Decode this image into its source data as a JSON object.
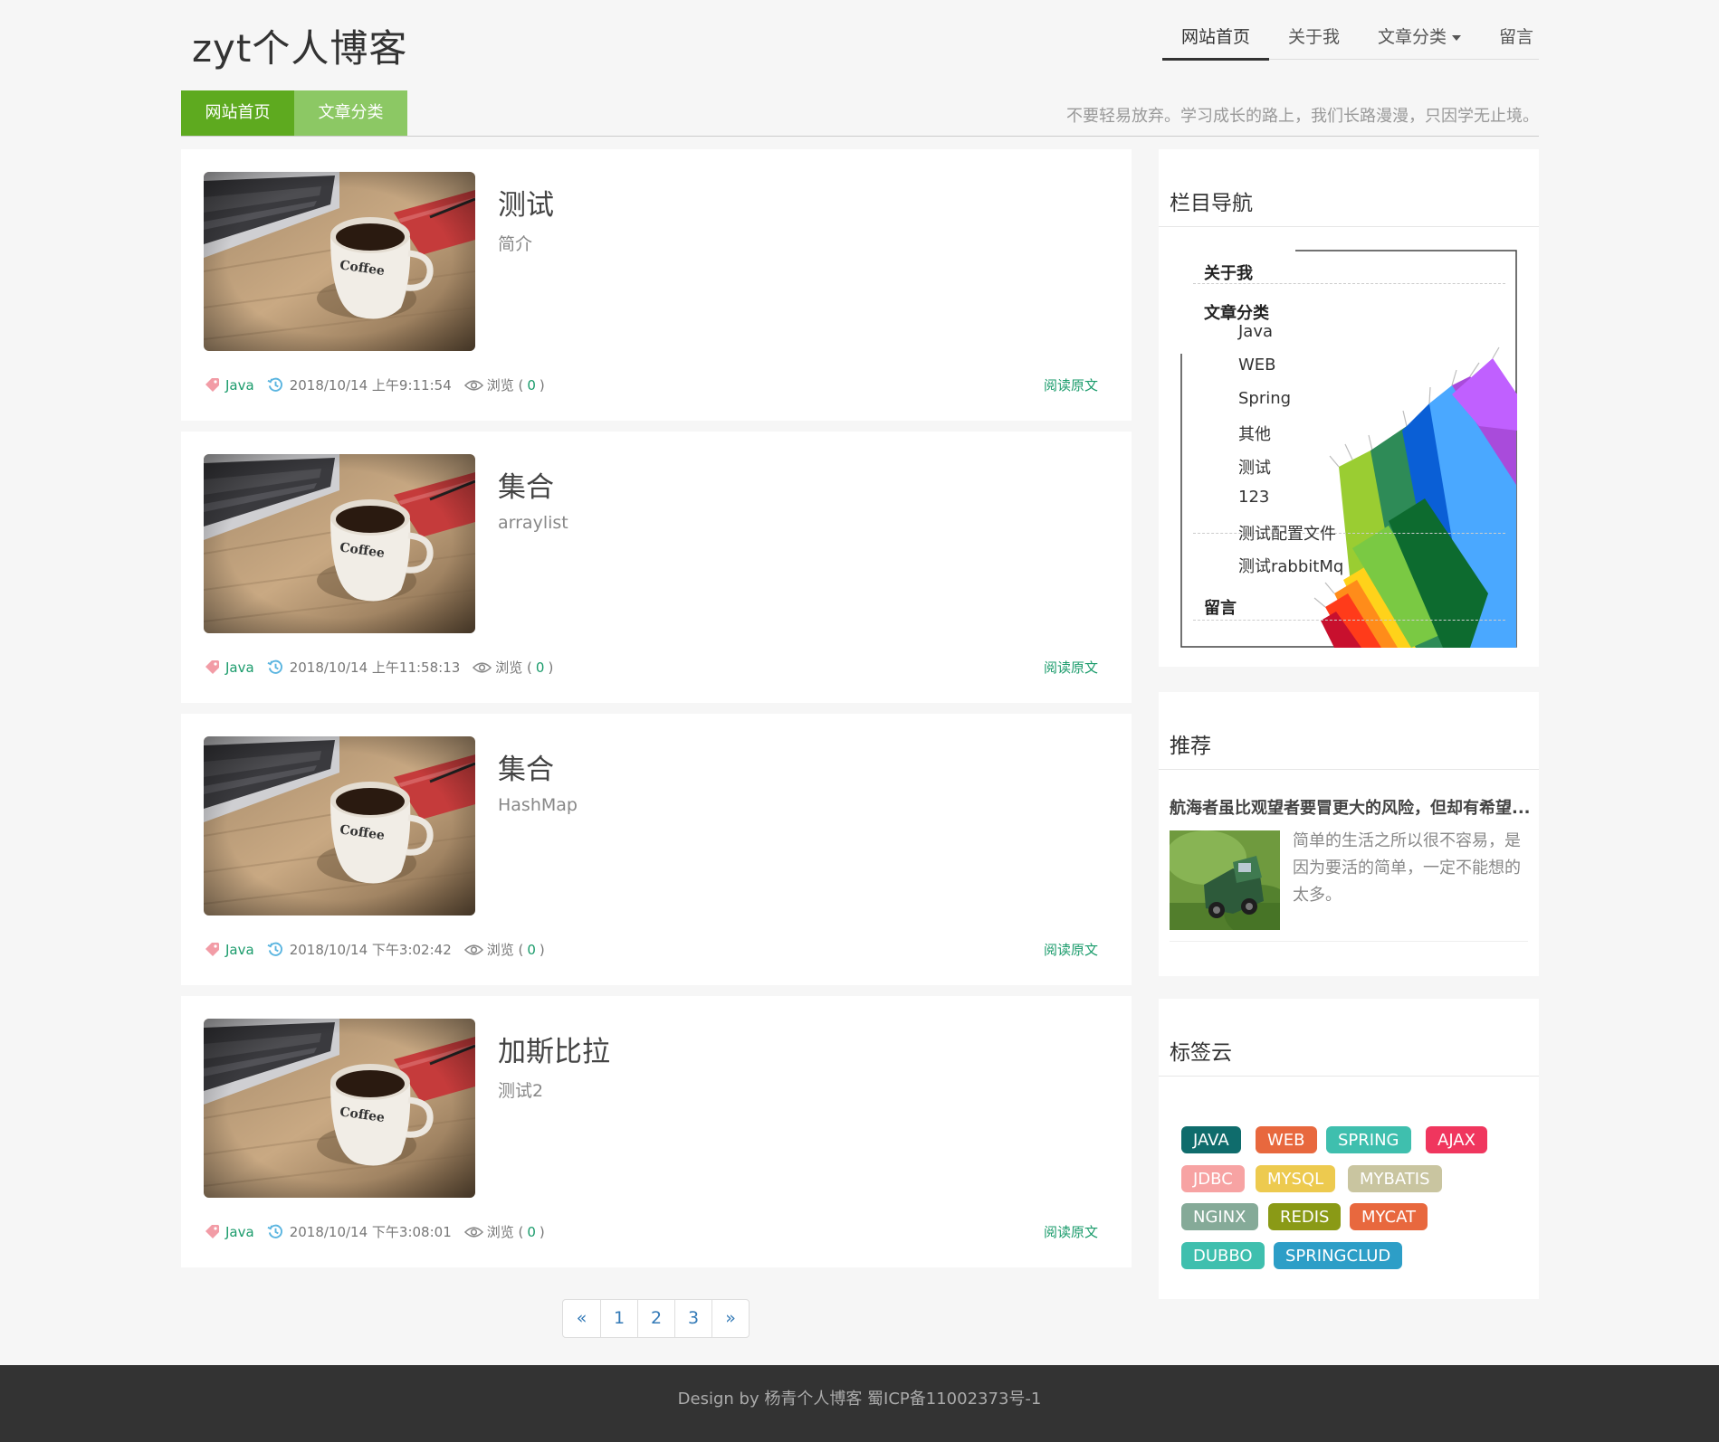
{
  "header": {
    "site_title": "zyt个人博客",
    "nav": [
      {
        "label": "网站首页",
        "active": true
      },
      {
        "label": "关于我",
        "active": false
      },
      {
        "label": "文章分类",
        "active": false,
        "dropdown": true
      },
      {
        "label": "留言",
        "active": false
      }
    ]
  },
  "subbar": {
    "tab_home": "网站首页",
    "tab_category": "文章分类",
    "motto": "不要轻易放弃。学习成长的路上，我们长路漫漫，只因学无止境。"
  },
  "articles": [
    {
      "title": "测试",
      "desc": "简介",
      "tag": "Java",
      "date": "2018/10/14 上午9:11:54",
      "views_label": "浏览 (",
      "views": "0",
      "views_end": ")",
      "read_more": "阅读原文"
    },
    {
      "title": "集合",
      "desc": "arraylist",
      "tag": "Java",
      "date": "2018/10/14 上午11:58:13",
      "views_label": "浏览 (",
      "views": "0",
      "views_end": ")",
      "read_more": "阅读原文"
    },
    {
      "title": "集合",
      "desc": "HashMap",
      "tag": "Java",
      "date": "2018/10/14 下午3:02:42",
      "views_label": "浏览 (",
      "views": "0",
      "views_end": ")",
      "read_more": "阅读原文"
    },
    {
      "title": "加斯比拉",
      "desc": "测试2",
      "tag": "Java",
      "date": "2018/10/14 下午3:08:01",
      "views_label": "浏览 (",
      "views": "0",
      "views_end": ")",
      "read_more": "阅读原文"
    }
  ],
  "pagination": {
    "prev": "«",
    "pages": [
      "1",
      "2",
      "3"
    ],
    "next": "»"
  },
  "sidebar": {
    "column_nav": {
      "title": "栏目导航",
      "about": "关于我",
      "category": "文章分类",
      "subcategories": [
        "Java",
        "WEB",
        "Spring",
        "其他",
        "测试",
        "123",
        "测试配置文件",
        "测试rabbitMq"
      ],
      "message": "留言"
    },
    "recommend": {
      "title": "推荐",
      "item_title": "航海者虽比观望者要冒更大的风险，但却有希望...",
      "item_text": "简单的生活之所以很不容易，是因为要活的简单，一定不能想的太多。"
    },
    "tag_cloud": {
      "title": "标签云",
      "tags": [
        {
          "label": "JAVA",
          "color": "#0f6c6c"
        },
        {
          "label": "WEB",
          "color": "#e8683e"
        },
        {
          "label": "SPRING",
          "color": "#3fbfae"
        },
        {
          "label": "AJAX",
          "color": "#f0365e"
        },
        {
          "label": "JDBC",
          "color": "#f7a3a3"
        },
        {
          "label": "MYSQL",
          "color": "#edca4f"
        },
        {
          "label": "MYBATIS",
          "color": "#c9c5a0"
        },
        {
          "label": "NGINX",
          "color": "#85aa98"
        },
        {
          "label": "REDIS",
          "color": "#8a9a16"
        },
        {
          "label": "MYCAT",
          "color": "#e8683e"
        },
        {
          "label": "DUBBO",
          "color": "#3fbfae"
        },
        {
          "label": "SPRINGCLUD",
          "color": "#2d9ec7"
        }
      ]
    }
  },
  "footer": {
    "text": "Design by 杨青个人博客 蜀ICP备11002373号-1"
  },
  "colors": {
    "accent_green": "#5eaa1f",
    "light_green": "#8cc864",
    "link_green": "#1a9b6b"
  }
}
